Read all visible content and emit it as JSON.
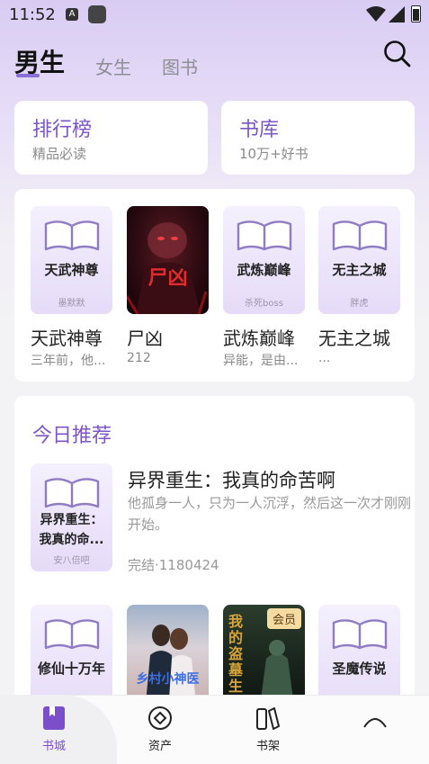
{
  "status_bar": {
    "time": "11:52",
    "a_badge": "A"
  },
  "tabs": [
    {
      "label": "男生",
      "active": true
    },
    {
      "label": "女生",
      "active": false
    },
    {
      "label": "图书",
      "active": false
    }
  ],
  "quick_links": [
    {
      "title": "排行榜",
      "subtitle": "精品必读"
    },
    {
      "title": "书库",
      "subtitle": "10万+好书"
    }
  ],
  "grid_books": [
    {
      "cover_title": "天武神尊",
      "cover_author": "墨默默",
      "title": "天武神尊",
      "subtitle": "三年前，他..."
    },
    {
      "cover_text": "尸凶",
      "title": "尸凶",
      "subtitle": "212"
    },
    {
      "cover_title": "武炼巅峰",
      "cover_author": "杀死boss",
      "title": "武炼巅峰",
      "subtitle": "异能，是由..."
    },
    {
      "cover_title": "无主之城",
      "cover_author": "胖虎",
      "title": "无主之城",
      "subtitle": "..."
    }
  ],
  "recommend": {
    "heading": "今日推荐",
    "featured": {
      "cover_title": "异界重生：我真的命...",
      "cover_author": "安八倍吧",
      "title": "异界重生：我真的命苦啊",
      "description": "他孤身一人，只为一人沉浮，然后这一次才刚刚开始。",
      "meta": "完结·1180424"
    },
    "row": [
      {
        "cover_title": "修仙十万年",
        "cover_author": ""
      },
      {
        "cover_text": "乡村小神医"
      },
      {
        "cover_text": "我的盗墓生涯",
        "badge": "会员"
      },
      {
        "cover_title": "圣魔传说",
        "cover_author": ""
      }
    ]
  },
  "nav": [
    {
      "label": "书城",
      "icon": "bookstore-icon",
      "active": true
    },
    {
      "label": "资产",
      "icon": "assets-icon",
      "active": false
    },
    {
      "label": "书架",
      "icon": "bookshelf-icon",
      "active": false
    },
    {
      "label": "",
      "icon": "profile-icon",
      "active": false
    }
  ],
  "colors": {
    "accent": "#7b56c4",
    "nav_active": "#7b4fc9"
  }
}
